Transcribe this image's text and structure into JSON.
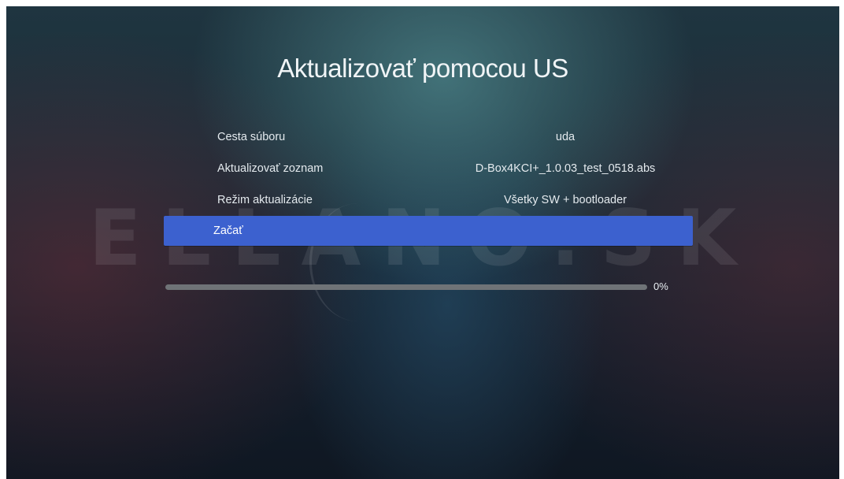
{
  "screen": {
    "title": "Aktualizovať pomocou US",
    "watermark": "ELLANO.SK"
  },
  "menu": {
    "items": [
      {
        "label": "Cesta súboru",
        "value": "uda"
      },
      {
        "label": "Aktualizovať zoznam",
        "value": "D-Box4KCI+_1.0.03_test_0518.abs"
      },
      {
        "label": "Režim aktualizácie",
        "value": "Všetky SW + bootloader"
      }
    ],
    "start_label": "Začať"
  },
  "progress": {
    "percent": 0,
    "text": "0%"
  },
  "colors": {
    "selection": "#3c61cf",
    "track": "#6f7377"
  }
}
